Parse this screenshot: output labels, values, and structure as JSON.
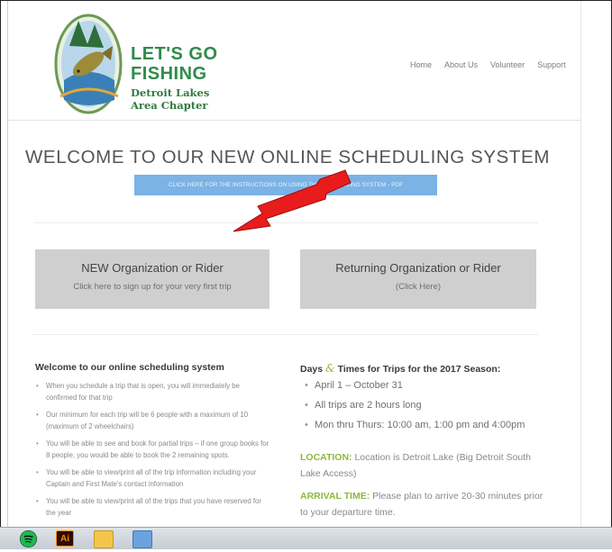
{
  "logo": {
    "title_line1": "LET'S GO",
    "title_line2": "FISHING",
    "subtitle_line1": "Detroit Lakes",
    "subtitle_line2": "Area Chapter"
  },
  "nav": {
    "items": [
      "Home",
      "About Us",
      "Volunteer",
      "Support"
    ]
  },
  "main": {
    "title": "WELCOME TO OUR NEW ONLINE SCHEDULING SYSTEM",
    "pdf_button": "CLICK HERE FOR THE INSTRUCTIONS ON USING THE SCHEDULING SYSTEM - PDF"
  },
  "cards": {
    "new": {
      "title": "NEW Organization or Rider",
      "subtitle": "Click here to sign up for your very first trip"
    },
    "returning": {
      "title": "Returning Organization or Rider",
      "subtitle": "(Click Here)"
    }
  },
  "welcome": {
    "title": "Welcome to our online scheduling system",
    "bullets": [
      "When you schedule a trip that is open, you will immediately be confirmed for that trip",
      "Our minimum for each trip will be 6 people with a maximum of 10 (maximum of 2 wheelchairs)",
      "You will be able to see and book for partial trips – if one group books for 8 people, you would be able to book the 2 remaining spots.",
      "You will be able to view/print all of the trip information including your Captain and First Mate's contact information",
      "You will be able to view/print all of the trips that you have reserved for the year"
    ]
  },
  "days": {
    "title_prefix": "Days",
    "amp": "&",
    "title_suffix": "Times for Trips for the 2017 Season:",
    "bullets": [
      "April 1 – October 31",
      "All trips are 2 hours long",
      "Mon thru Thurs: 10:00 am, 1:00 pm and 4:00pm"
    ],
    "location_label": "LOCATION:",
    "location_text": "Location is Detroit Lake (Big Detroit South Lake Access)",
    "arrival_label": "ARRIVAL TIME:",
    "arrival_text": "Please plan to arrive 20-30 minutes prior to your departure time."
  },
  "taskbar": {
    "icons": [
      "spotify-icon",
      "illustrator-icon",
      "folder-icon",
      "app-icon"
    ],
    "ai_label": "Ai"
  },
  "colors": {
    "accent_green": "#8fb83c",
    "button_blue": "#7bb3e6",
    "arrow_red": "#e81c1c",
    "card_gray": "#cfcfcf"
  }
}
